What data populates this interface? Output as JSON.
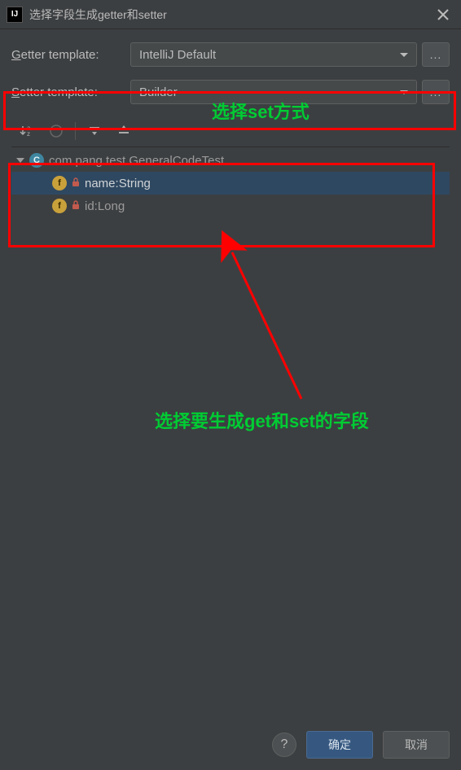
{
  "window": {
    "title": "选择字段生成getter和setter",
    "app_icon_text": "IJ"
  },
  "getter": {
    "label_prefix": "G",
    "label_rest": "etter template:",
    "value": "IntelliJ Default"
  },
  "setter": {
    "label_prefix": "S",
    "label_rest": "etter template:",
    "value": "Builder"
  },
  "more_label": "...",
  "annotations": {
    "set_method": "选择set方式",
    "fields": "选择要生成get和set的字段"
  },
  "tree": {
    "class_icon": "C",
    "field_icon": "f",
    "class_name": "com.pang.test.GeneralCodeTest",
    "fields": [
      {
        "label": "name:String"
      },
      {
        "label": "id:Long"
      }
    ]
  },
  "buttons": {
    "help": "?",
    "ok": "确定",
    "cancel": "取消"
  }
}
